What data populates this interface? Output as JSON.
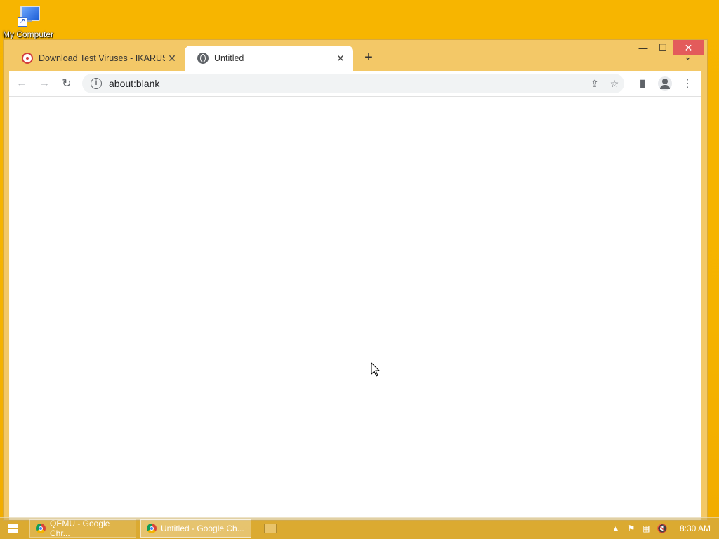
{
  "desktop": {
    "my_computer_label": "My Computer"
  },
  "window": {
    "minimize_glyph": "—",
    "maximize_glyph": "☐",
    "close_glyph": "✕"
  },
  "tabs": [
    {
      "title": "Download Test Viruses - IKARUS",
      "close": "✕",
      "icon": "ikarus-favicon"
    },
    {
      "title": "Untitled",
      "close": "✕",
      "icon": "globe-icon"
    }
  ],
  "tabstrip": {
    "new_tab_glyph": "+",
    "search_tabs_glyph": "⌄"
  },
  "toolbar": {
    "back_glyph": "←",
    "forward_glyph": "→",
    "reload_glyph": "↻",
    "info_glyph": "i",
    "url": "about:blank",
    "share_glyph": "⇪",
    "bookmark_glyph": "☆",
    "side_panel_glyph": "▮",
    "menu_glyph": "⋮"
  },
  "taskbar": {
    "items": [
      {
        "label": "QEMU - Google Chr..."
      },
      {
        "label": "Untitled - Google Ch..."
      }
    ],
    "tray": {
      "chevron": "▲",
      "flag": "⚑",
      "network": "▦",
      "volume": "🔇",
      "clock": "8:30 AM"
    }
  },
  "colors": {
    "desktop": "#f5b300",
    "window_frame": "#f3c867",
    "close_button": "#e35b5b"
  }
}
